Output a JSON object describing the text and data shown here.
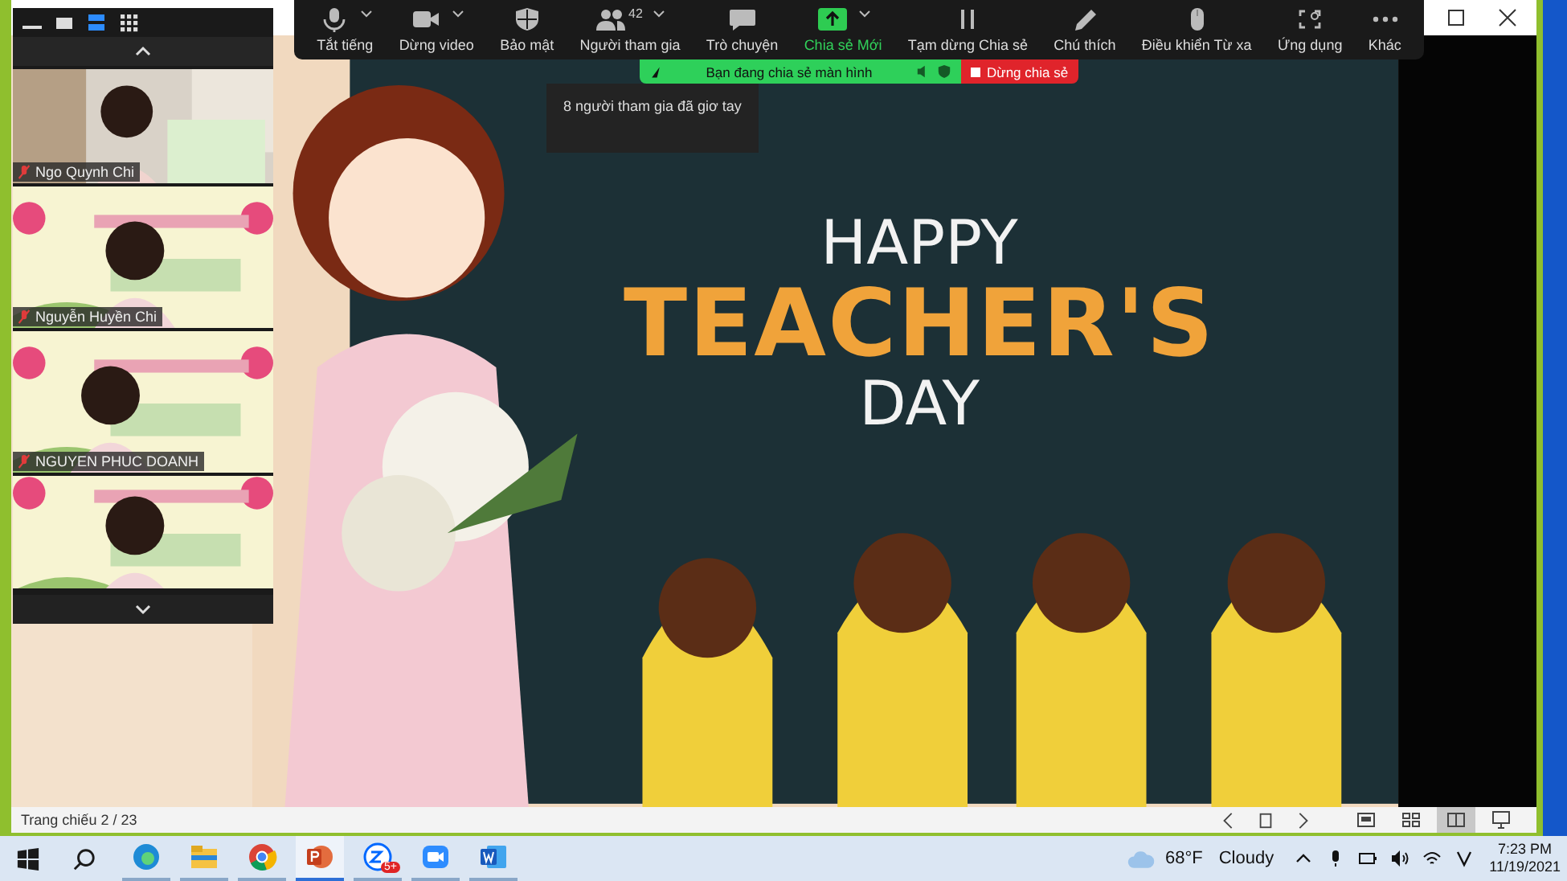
{
  "toolbar": {
    "items": [
      {
        "kind": "mic",
        "label": "Tắt tiếng",
        "dropdown": true,
        "active": false
      },
      {
        "kind": "video",
        "label": "Dừng video",
        "dropdown": true,
        "active": false
      },
      {
        "kind": "shield",
        "label": "Bảo mật",
        "dropdown": false,
        "active": false
      },
      {
        "kind": "people",
        "label": "Người tham gia",
        "count": "42",
        "dropdown": true,
        "active": false
      },
      {
        "kind": "chat",
        "label": "Trò chuyện",
        "dropdown": false,
        "active": false
      },
      {
        "kind": "share",
        "label": "Chia sẻ Mới",
        "dropdown": true,
        "active": true
      },
      {
        "kind": "pause",
        "label": "Tạm dừng Chia sẻ",
        "dropdown": false,
        "active": false
      },
      {
        "kind": "pencil",
        "label": "Chú thích",
        "dropdown": false,
        "active": false
      },
      {
        "kind": "mouse",
        "label": "Điều khiển Từ xa",
        "dropdown": false,
        "active": false
      },
      {
        "kind": "apps",
        "label": "Ứng dụng",
        "dropdown": false,
        "active": false
      },
      {
        "kind": "more",
        "label": "Khác",
        "dropdown": false,
        "active": false
      }
    ]
  },
  "share_banner": {
    "message": "Bạn đang chia sẻ màn hình",
    "stop_label": "Dừng chia sẻ"
  },
  "notification": "8 người tham gia đã giơ tay",
  "gallery": {
    "views": [
      {
        "kind": "minimize",
        "selected": false
      },
      {
        "kind": "single",
        "selected": false
      },
      {
        "kind": "strip",
        "selected": true
      },
      {
        "kind": "grid",
        "selected": false
      }
    ],
    "participants": [
      {
        "name": "Ngo Quynh Chi",
        "muted": true,
        "kind": "room"
      },
      {
        "name": "Nguyễn Huyền Chi",
        "muted": true,
        "kind": "banner"
      },
      {
        "name": "NGUYEN PHUC DOANH",
        "muted": true,
        "kind": "banner"
      },
      {
        "kind": "banner"
      }
    ]
  },
  "slide": {
    "kind": "picture",
    "title_lines": [
      "HAPPY",
      "TEACHER'S",
      "DAY"
    ]
  },
  "status_bar": {
    "slide_counter": "Trang chiếu 2 / 23",
    "views": [
      {
        "kind": "normal",
        "selected": false
      },
      {
        "kind": "sorter",
        "selected": false
      },
      {
        "kind": "reading",
        "selected": true
      },
      {
        "kind": "show",
        "selected": false
      }
    ]
  },
  "taskbar": {
    "apps": [
      {
        "kind": "edge",
        "selected": false
      },
      {
        "kind": "files",
        "selected": false
      },
      {
        "kind": "chrome",
        "selected": false
      },
      {
        "kind": "powerpoint",
        "selected": true
      },
      {
        "kind": "zalo",
        "badge": "5+",
        "selected": false
      },
      {
        "kind": "zoom",
        "selected": false
      },
      {
        "kind": "word",
        "selected": false
      }
    ],
    "weather": {
      "temp": "68°F",
      "condition": "Cloudy"
    },
    "time": "7:23 PM",
    "date": "11/19/2021"
  }
}
